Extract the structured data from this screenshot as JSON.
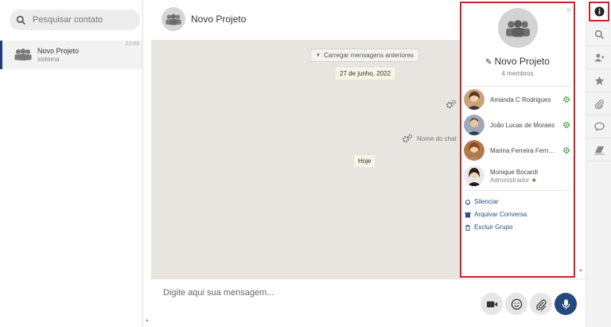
{
  "sidebar": {
    "search": {
      "placeholder": "Pesquisar contato",
      "icon": "search-icon"
    },
    "contacts": [
      {
        "name": "Novo Projeto",
        "subtitle": "sistema",
        "time": "23:59"
      }
    ]
  },
  "chat": {
    "title": "Novo Projeto",
    "load_previous": "Carregar mensagens anteriores",
    "date_pill": "27 de junho, 2022",
    "system_event": "Nome do chat",
    "today_pill": "Hoje",
    "composer_placeholder": "Digite aqui sua mensagem..."
  },
  "info_panel": {
    "group_name": "Novo Projeto",
    "member_count": "4 membros",
    "members": [
      {
        "name": "Amanda C Rodrigues",
        "role": ""
      },
      {
        "name": "João Lucas de Moraes",
        "role": ""
      },
      {
        "name": "Marina Ferreira Ferna...",
        "role": ""
      },
      {
        "name": "Monique Bocardi",
        "role": "Administrador"
      }
    ],
    "actions": [
      {
        "label": "Silenciar",
        "icon": "bell-icon"
      },
      {
        "label": "Arquivar Conversa",
        "icon": "archive-icon"
      },
      {
        "label": "Excluir Grupo",
        "icon": "trash-icon"
      }
    ]
  },
  "rail": {
    "tools": [
      "info-icon",
      "search-icon",
      "add-user-icon",
      "star-icon",
      "paperclip-icon",
      "chat-bubble-icon",
      "eraser-icon"
    ]
  },
  "colors": {
    "accent": "#234a7a",
    "highlight": "#c8232c",
    "admin_gear": "#4a9a3e",
    "star": "#6b6b2a"
  }
}
